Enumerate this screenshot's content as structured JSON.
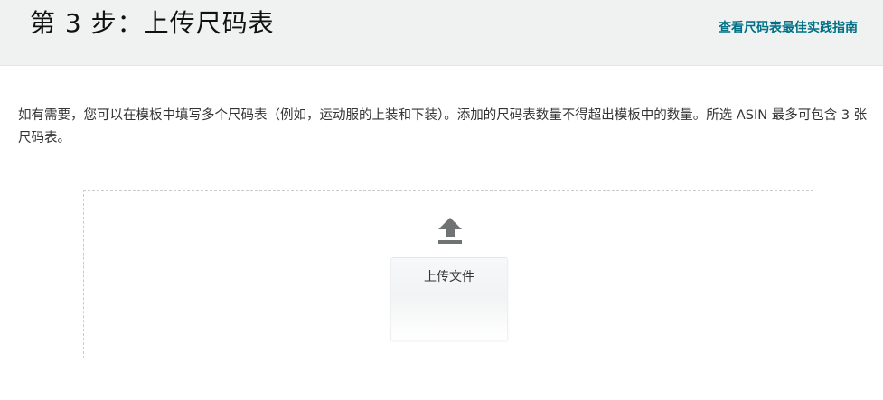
{
  "header": {
    "step_title": "第 3 步：上传尺码表",
    "guide_link": "查看尺码表最佳实践指南"
  },
  "description": "如有需要，您可以在模板中填写多个尺码表（例如，运动服的上装和下装）。添加的尺码表数量不得超出模板中的数量。所选 ASIN 最多可包含 3 张尺码表。",
  "upload": {
    "icon": "upload-icon",
    "button_label": "上传文件"
  },
  "colors": {
    "header_bg": "#f0f2f2",
    "link": "#007185",
    "icon": "#6f7373",
    "dashed_border": "#c9cccc"
  }
}
